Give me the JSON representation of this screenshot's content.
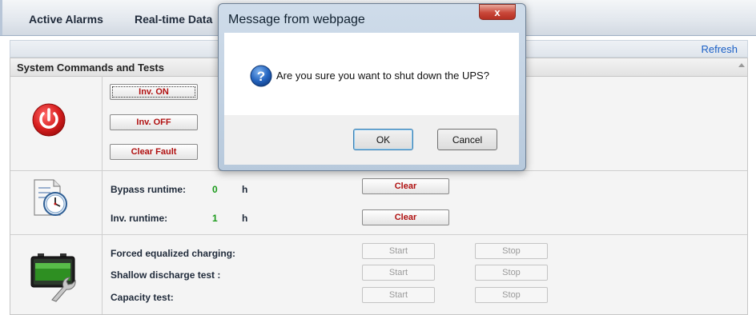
{
  "tabs": [
    "Active Alarms",
    "Real-time Data"
  ],
  "toolbar": {
    "refresh": "Refresh"
  },
  "panel": {
    "title": "System Commands and Tests",
    "inverter": {
      "on_label": "Inv. ON",
      "off_label": "Inv. OFF",
      "clear_fault_label": "Clear Fault"
    },
    "runtime": {
      "bypass_label": "Bypass runtime:",
      "bypass_value": "0",
      "bypass_unit": "h",
      "inv_label": "Inv. runtime:",
      "inv_value": "1",
      "inv_unit": "h",
      "clear_label": "Clear"
    },
    "tests": {
      "rows": [
        "Forced equalized charging:",
        "Shallow discharge test :",
        "Capacity test:"
      ],
      "start_label": "Start",
      "stop_label": "Stop"
    }
  },
  "dialog": {
    "title": "Message from webpage",
    "close_glyph": "x",
    "message": "Are you sure you want to shut down the UPS?",
    "ok_label": "OK",
    "cancel_label": "Cancel"
  },
  "icons": {
    "power": "power-icon",
    "clock": "clock-document-icon",
    "battery": "battery-wrench-icon",
    "question": "question-icon"
  },
  "colors": {
    "command_text": "#b01010",
    "value_text": "#1a9a1a",
    "link": "#1a5fc6",
    "power_red": "#d42020"
  }
}
